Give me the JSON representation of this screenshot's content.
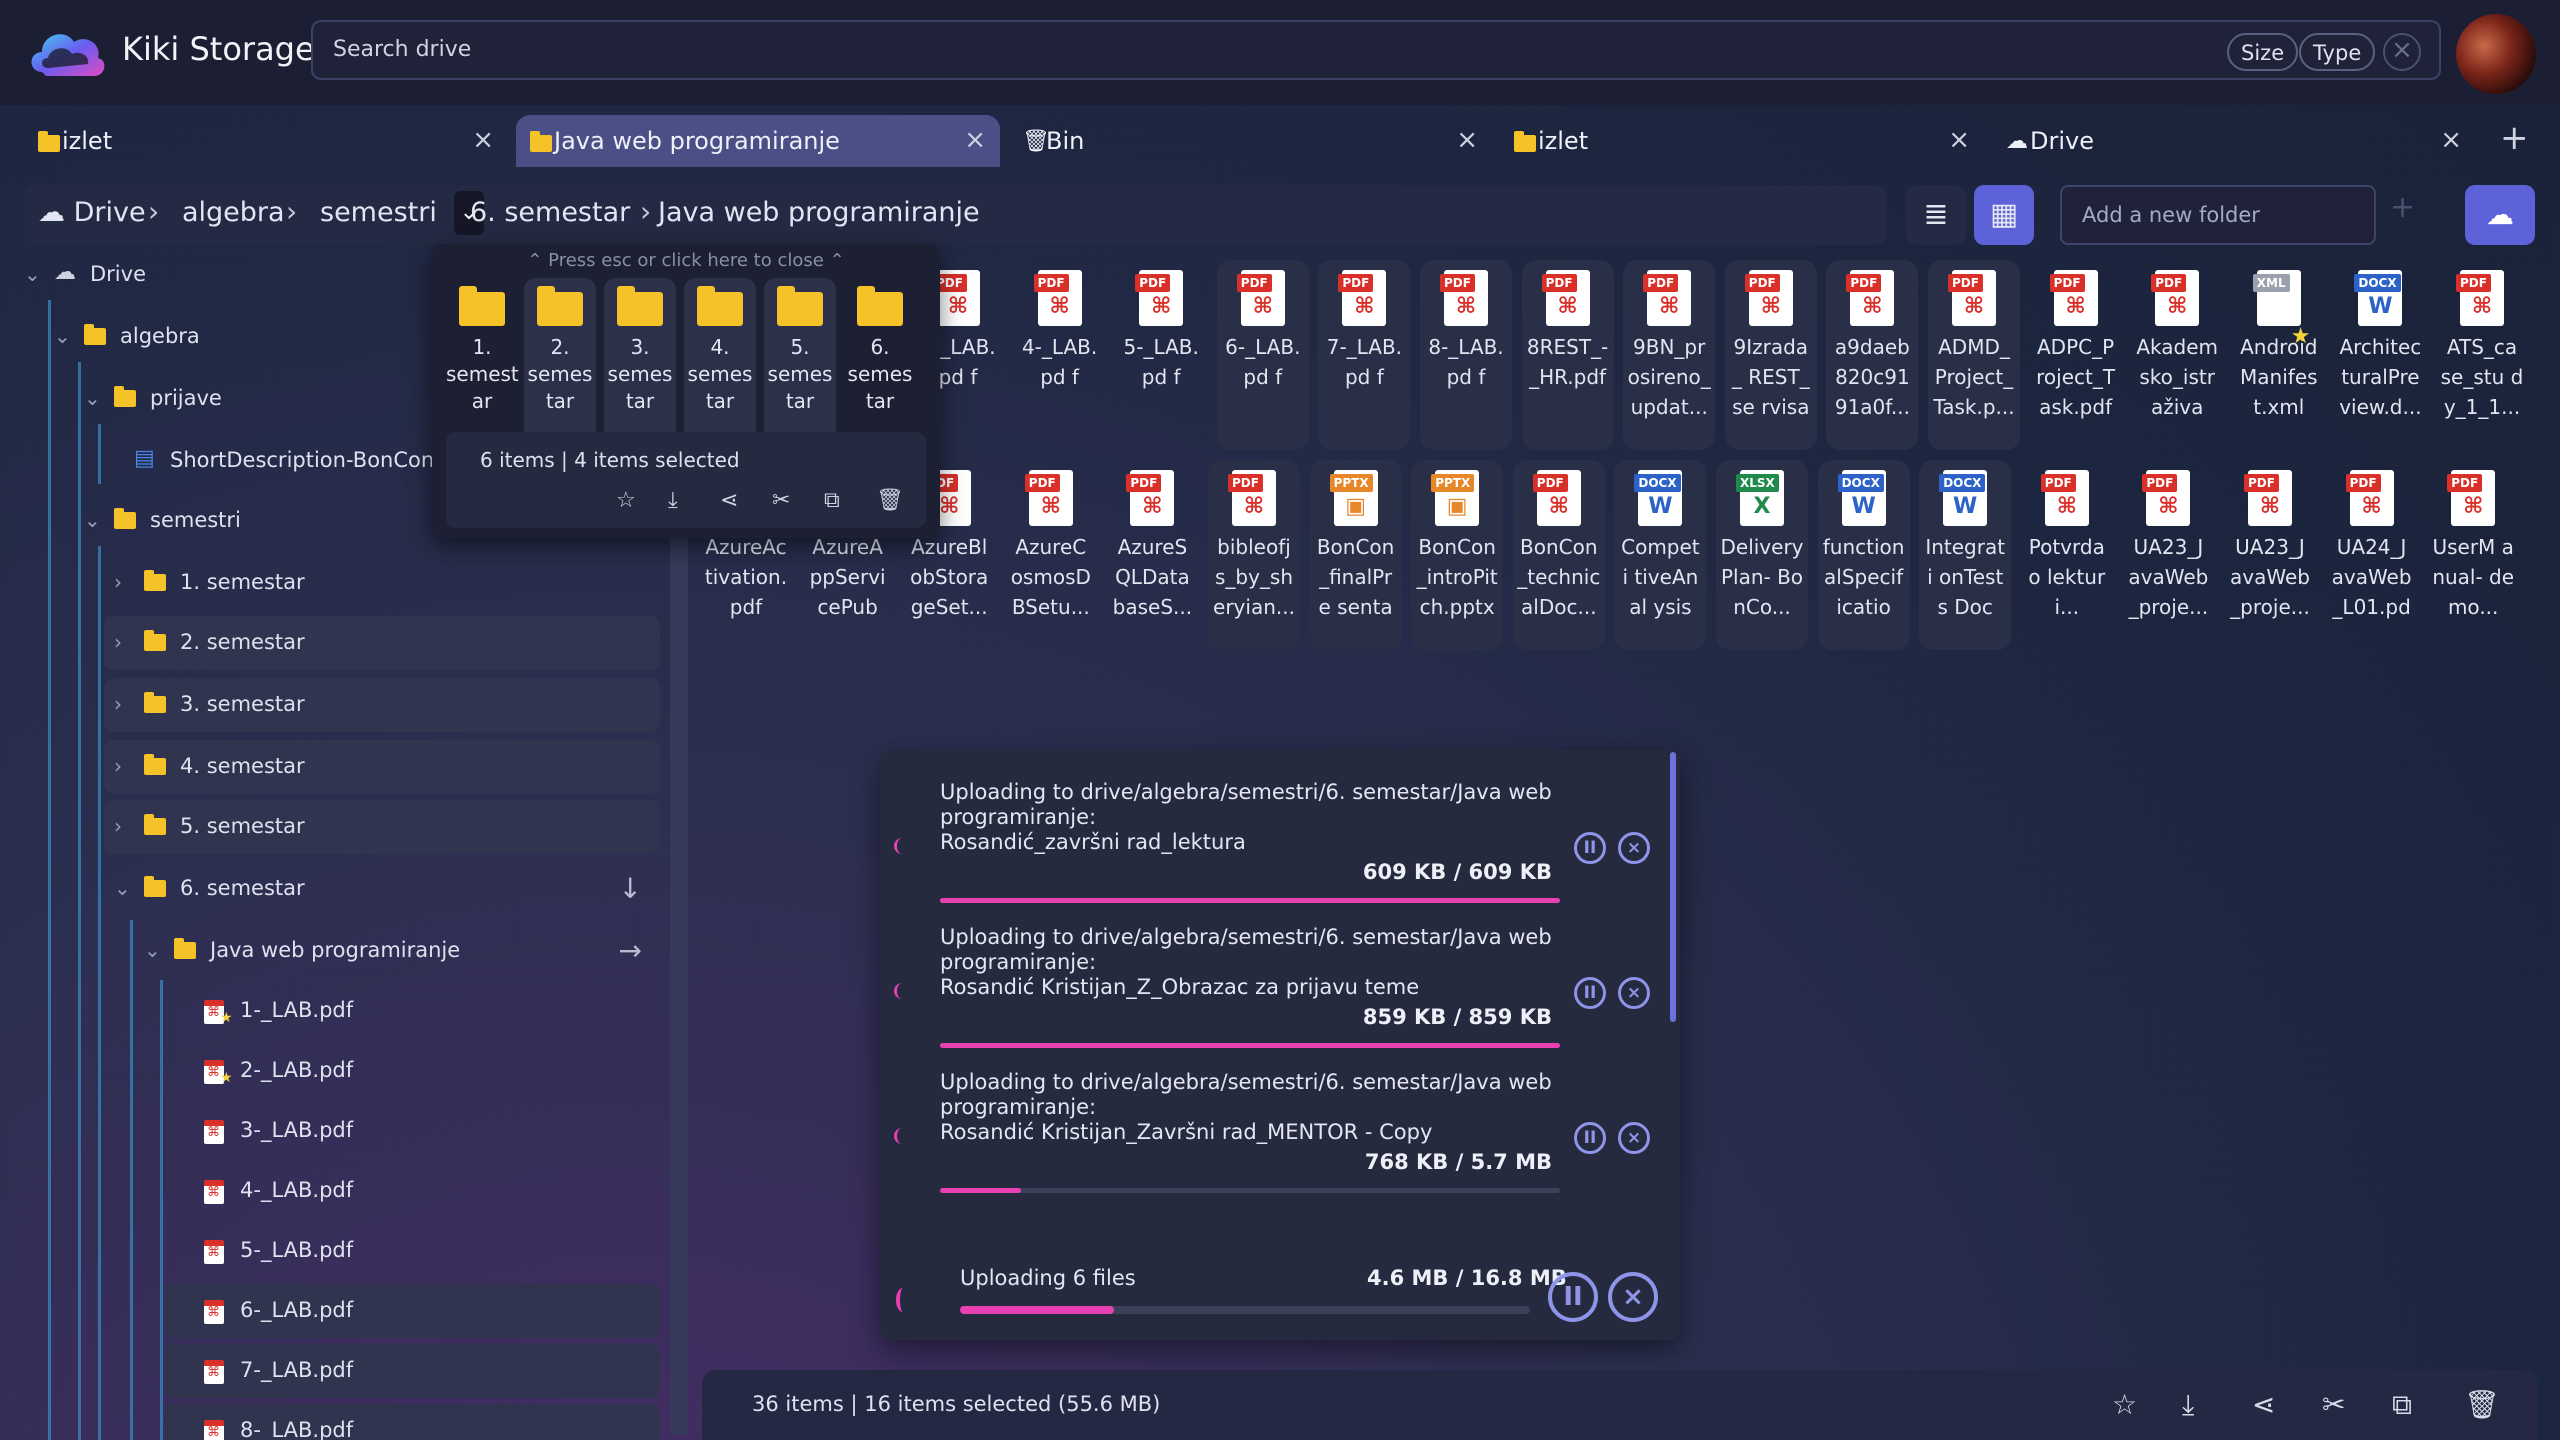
{
  "app": {
    "title": "Kiki Storage"
  },
  "search": {
    "placeholder": "Search drive",
    "chips": [
      "Size",
      "Type"
    ]
  },
  "tabs": [
    {
      "label": "izlet",
      "icon": "folder-icon"
    },
    {
      "label": "Java web programiranje",
      "icon": "folder-icon",
      "active": true
    },
    {
      "label": "Bin",
      "icon": "trash-icon"
    },
    {
      "label": "izlet",
      "icon": "folder-icon"
    },
    {
      "label": "Drive",
      "icon": "cloud-icon"
    }
  ],
  "breadcrumb": [
    "Drive",
    "algebra",
    "semestri",
    "6. semestar",
    "Java web programiranje"
  ],
  "toolbar": {
    "new_folder_placeholder": "Add a new folder"
  },
  "tree": [
    {
      "label": "Drive",
      "type": "cloud"
    },
    {
      "label": "algebra",
      "type": "folder"
    },
    {
      "label": "prijave",
      "type": "folder"
    },
    {
      "label": "ShortDescription-BonCon.d",
      "type": "doc"
    },
    {
      "label": "semestri",
      "type": "folder"
    },
    {
      "label": "1. semestar",
      "type": "folder"
    },
    {
      "label": "2. semestar",
      "type": "folder"
    },
    {
      "label": "3. semestar",
      "type": "folder"
    },
    {
      "label": "4. semestar",
      "type": "folder"
    },
    {
      "label": "5. semestar",
      "type": "folder"
    },
    {
      "label": "6. semestar",
      "type": "folder"
    },
    {
      "label": "Java web programiranje",
      "type": "folder"
    },
    {
      "label": "1-_LAB.pdf",
      "type": "pdf"
    },
    {
      "label": "2-_LAB.pdf",
      "type": "pdf"
    },
    {
      "label": "3-_LAB.pdf",
      "type": "pdf"
    },
    {
      "label": "4-_LAB.pdf",
      "type": "pdf"
    },
    {
      "label": "5-_LAB.pdf",
      "type": "pdf"
    },
    {
      "label": "6-_LAB.pdf",
      "type": "pdf"
    },
    {
      "label": "7-_LAB.pdf",
      "type": "pdf"
    },
    {
      "label": "8-_LAB.pdf",
      "type": "pdf"
    }
  ],
  "popover": {
    "hint": "Press esc or click here to close",
    "items": [
      "1. semest ar",
      "2. semes tar",
      "3. semes tar",
      "4. semes tar",
      "5. semes tar",
      "6. semes tar"
    ],
    "count": "6 items",
    "selected": "4 items selected"
  },
  "files_row1": [
    {
      "name": "3-_LAB.pd f",
      "kind": "PDF",
      "sel": false
    },
    {
      "name": "4-_LAB.pd f",
      "kind": "PDF",
      "sel": false
    },
    {
      "name": "5-_LAB.pd f",
      "kind": "PDF",
      "sel": false
    },
    {
      "name": "6-_LAB.pd f",
      "kind": "PDF",
      "sel": true
    },
    {
      "name": "7-_LAB.pd f",
      "kind": "PDF",
      "sel": true
    },
    {
      "name": "8-_LAB.pd f",
      "kind": "PDF",
      "sel": true
    },
    {
      "name": "8REST_-_HR.pdf",
      "kind": "PDF",
      "sel": true
    },
    {
      "name": "9BN_pr osireno_ updat...",
      "kind": "PDF",
      "sel": true
    },
    {
      "name": "9Izrada_ REST_se rvisa_...",
      "kind": "PDF",
      "sel": true
    },
    {
      "name": "a9daeb 820c91 91a0f...",
      "kind": "PDF",
      "sel": true
    },
    {
      "name": "ADMD_ Project_ Task.p...",
      "kind": "PDF",
      "sel": true
    },
    {
      "name": "ADPC_P roject_T ask.pdf",
      "kind": "PDF",
      "sel": false
    },
    {
      "name": "Akadem sko_istr aživan...",
      "kind": "PDF",
      "sel": false
    },
    {
      "name": "Android Manifes t.xml",
      "kind": "XML",
      "sel": false
    },
    {
      "name": "Architec turalPre view.d...",
      "kind": "DOCX",
      "sel": false
    },
    {
      "name": "ATS_ca se_stu dy_1_1...",
      "kind": "PDF",
      "sel": false
    }
  ],
  "files_row2": [
    {
      "name": "AzureAc tivation. pdf",
      "kind": "PDF",
      "sel": false
    },
    {
      "name": "AzureA ppServi cePubl...",
      "kind": "PDF",
      "sel": false
    },
    {
      "name": "AzureBl obStora geSet...",
      "kind": "PDF",
      "sel": false
    },
    {
      "name": "AzureC osmosD BSetu...",
      "kind": "PDF",
      "sel": false
    },
    {
      "name": "AzureS QLData baseS...",
      "kind": "PDF",
      "sel": false
    },
    {
      "name": "bibleofj s_by_sh eryian...",
      "kind": "PDF",
      "sel": true
    },
    {
      "name": "BonCon _finalPre sentat...",
      "kind": "PPTX",
      "sel": true
    },
    {
      "name": "BonCon _introPit ch.pptx",
      "kind": "PPTX",
      "sel": true
    },
    {
      "name": "BonCon _technic alDoc...",
      "kind": "PDF",
      "sel": true
    },
    {
      "name": "Competi tiveAnal ysis-...",
      "kind": "DOCX",
      "sel": true
    },
    {
      "name": "Delivery Plan- BonCo...",
      "kind": "XLSX",
      "sel": true
    },
    {
      "name": "function alSpecif ication...",
      "kind": "DOCX",
      "sel": true
    },
    {
      "name": "Integrati onTests Docu...",
      "kind": "DOCX",
      "sel": true
    },
    {
      "name": "Potvrda o lekturi...",
      "kind": "PDF",
      "sel": false
    },
    {
      "name": "UA23_J avaWeb _proje...",
      "kind": "PDF",
      "sel": false
    },
    {
      "name": "UA23_J avaWeb _proje...",
      "kind": "PDF",
      "sel": false
    },
    {
      "name": "UA24_J avaWeb _L01.pdf",
      "kind": "PDF",
      "sel": false
    },
    {
      "name": "UserM anual- demo...",
      "kind": "PDF",
      "sel": false
    }
  ],
  "uploads": [
    {
      "text1": "Uploading to drive/algebra/semestri/6. semestar/Java web programiranje:",
      "text2": "Rosandić_završni rad_lektura",
      "size": "609 KB / 609 KB",
      "progress": 1.0
    },
    {
      "text1": "Uploading to drive/algebra/semestri/6. semestar/Java web programiranje:",
      "text2": "Rosandić Kristijan_Z_Obrazac za prijavu teme",
      "size": "859 KB / 859 KB",
      "progress": 1.0
    },
    {
      "text1": "Uploading to drive/algebra/semestri/6. semestar/Java web programiranje:",
      "text2": "Rosandić Kristijan_Završni rad_MENTOR - Copy",
      "size": "768 KB / 5.7 MB",
      "progress": 0.13
    },
    {
      "text1": "Uploading to drive/algebra/semestri/6. semestar/Java web programiranje:",
      "text2": "",
      "size": "",
      "progress": 0
    }
  ],
  "upload_summary": {
    "label": "Uploading 6 files",
    "size": "4.6 MB / 16.8 MB",
    "progress": 0.27
  },
  "status": {
    "count": "36 items",
    "selected": "16 items selected (55.6 MB)"
  }
}
